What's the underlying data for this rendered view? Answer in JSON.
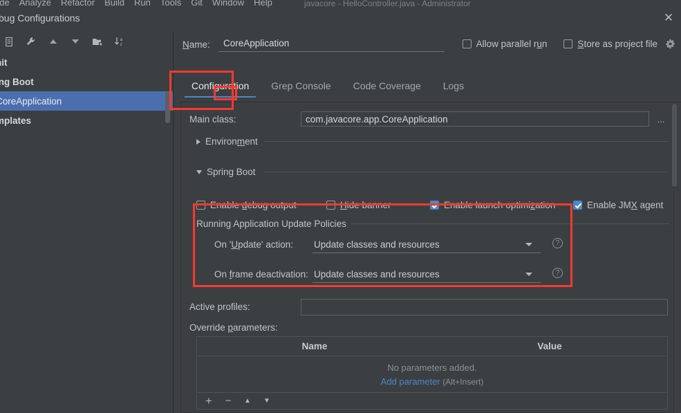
{
  "ide": {
    "menu_items": [
      "ode",
      "Analyze",
      "Refactor",
      "Build",
      "Run",
      "Tools",
      "Git",
      "Window",
      "Help"
    ],
    "window_title": "javacore - HelloController.java - Administrator"
  },
  "dialog": {
    "title": "bug Configurations",
    "close_label": "✕"
  },
  "toolbar": {
    "buttons": [
      {
        "name": "copy-configuration",
        "icon": "copy-icon"
      },
      {
        "name": "edit-templates",
        "icon": "wrench-icon"
      },
      {
        "name": "move-up",
        "icon": "arrow-up-icon"
      },
      {
        "name": "move-down",
        "icon": "arrow-down-icon"
      },
      {
        "name": "create-folder",
        "icon": "folder-add-icon"
      },
      {
        "name": "sort-configurations",
        "icon": "sort-az-icon"
      }
    ]
  },
  "sidebar": {
    "items": [
      {
        "label": "nit",
        "type": "group",
        "selected": false
      },
      {
        "label": "ing Boot",
        "type": "group",
        "selected": false
      },
      {
        "label": "CoreApplication",
        "type": "item",
        "selected": true
      },
      {
        "label": "mplates",
        "type": "group",
        "selected": false
      }
    ]
  },
  "form": {
    "name_label": "Name:",
    "name_value": "CoreApplication",
    "allow_parallel_run": {
      "label": "Allow parallel run",
      "checked": false
    },
    "store_as_project_file": {
      "label": "Store as project file",
      "checked": false
    }
  },
  "tabs": [
    {
      "label": "Configuration",
      "active": true
    },
    {
      "label": "Grep Console",
      "active": false
    },
    {
      "label": "Code Coverage",
      "active": false
    },
    {
      "label": "Logs",
      "active": false
    }
  ],
  "configuration": {
    "main_class_label": "Main class:",
    "main_class_value": "com.javacore.app.CoreApplication",
    "browse_label": "...",
    "environment_label": "Environment",
    "spring_boot_label": "Spring Boot",
    "spring_checks": [
      {
        "label": "Enable debug output",
        "checked": false
      },
      {
        "label": "Hide banner",
        "checked": false
      },
      {
        "label": "Enable launch optimization",
        "checked": true
      },
      {
        "label": "Enable JMX agent",
        "checked": true
      }
    ],
    "policies": {
      "title": "Running Application Update Policies",
      "update_action_label": "On 'Update' action:",
      "update_action_value": "Update classes and resources",
      "frame_deactivation_label": "On frame deactivation:",
      "frame_deactivation_value": "Update classes and resources",
      "help_glyph": "?"
    },
    "active_profiles_label": "Active profiles:",
    "active_profiles_value": "",
    "override_parameters_label": "Override parameters:",
    "params_table": {
      "columns": [
        "Name",
        "Value"
      ],
      "rows": [],
      "empty_text": "No parameters added.",
      "add_link": "Add parameter",
      "add_shortcut": "(Alt+Insert)",
      "footer_buttons": [
        {
          "name": "add-parameter-button",
          "glyph": "+"
        },
        {
          "name": "remove-parameter-button",
          "glyph": "−"
        },
        {
          "name": "move-parameter-up-button",
          "glyph": "▲"
        },
        {
          "name": "move-parameter-down-button",
          "glyph": "▼"
        }
      ]
    }
  },
  "colors": {
    "background": "#3c3f41",
    "selection": "#4b6eaf",
    "accent": "#4a88c7",
    "annotation": "#f93a30",
    "link": "#4a88c7"
  }
}
